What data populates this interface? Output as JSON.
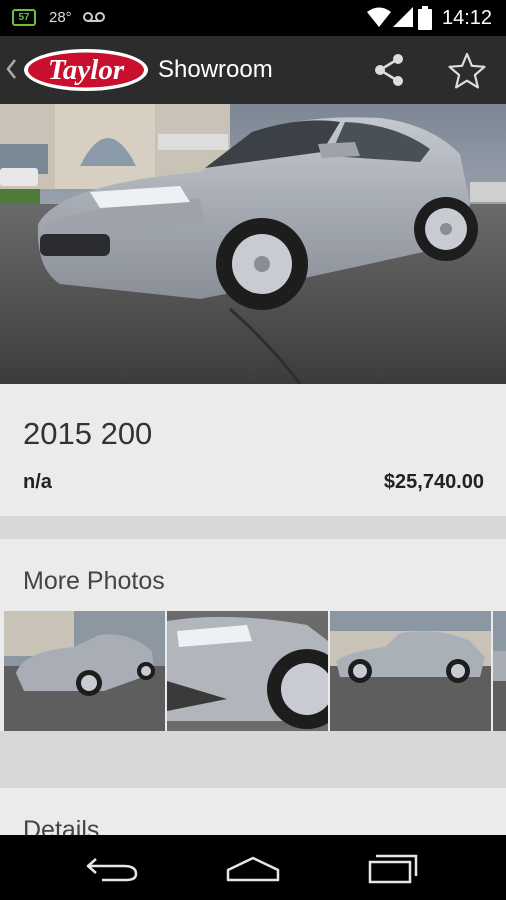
{
  "status_bar": {
    "notification_badge": "57",
    "temperature": "28°",
    "voicemail_icon": "voicemail-icon",
    "wifi_icon": "wifi-icon",
    "signal_icon": "signal-icon",
    "battery_icon": "battery-icon",
    "time": "14:12"
  },
  "action_bar": {
    "up_icon": "chevron-left-icon",
    "logo_text": "Taylor",
    "title": "Showroom",
    "share_icon": "share-icon",
    "favorite_icon": "star-outline-icon",
    "background": "#2c2c2c",
    "logo_color": "#c8102e"
  },
  "vehicle": {
    "title": "2015 200",
    "mileage": "n/a",
    "price": "$25,740.00"
  },
  "photos_section": {
    "title": "More Photos",
    "thumbnails": [
      "front-three-quarter",
      "headlight-wheel-closeup",
      "side-profile",
      "rear-partial"
    ]
  },
  "details_section": {
    "title": "Details"
  },
  "nav_bar": {
    "back_icon": "back-icon",
    "home_icon": "home-icon",
    "recents_icon": "recents-icon"
  }
}
